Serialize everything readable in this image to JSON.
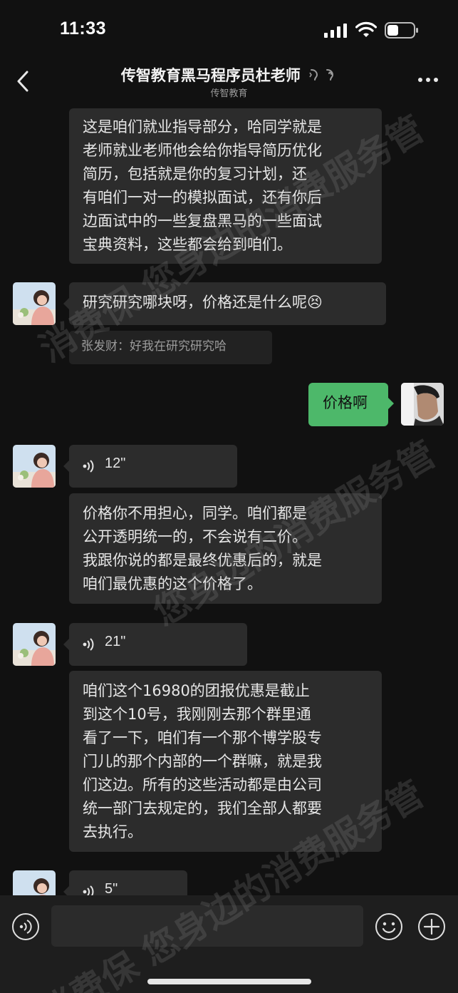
{
  "status_bar": {
    "time": "11:33",
    "signal_icon": "cellular-signal-icon",
    "wifi_icon": "wifi-icon",
    "battery_icon": "battery-icon"
  },
  "header": {
    "title": "传智教育黑马程序员杜老师",
    "subtitle": "传智教育",
    "back_icon": "chevron-left-icon",
    "more_icon": "more-dots-icon",
    "earpiece_icon": "earpiece-mode-icon"
  },
  "messages": [
    {
      "type": "text",
      "from": "other",
      "text": "这是咱们就业指导部分，哈同学就是老师就业老师他会给你指导简历优化简历，包括就是你的复习计划，还有咱们一对一的模拟面试，还有你后边面试中的一些复盘黑马的一些面试宝典资料，这些都会给到咱们。"
    },
    {
      "type": "text",
      "from": "other",
      "text": "研究研究哪块呀，价格还是什么呢",
      "emoji": "😣"
    },
    {
      "type": "quote",
      "text": "张发财：好我在研究研究哈"
    },
    {
      "type": "text",
      "from": "me",
      "text": "价格啊"
    },
    {
      "type": "voice",
      "from": "other",
      "duration": "12\""
    },
    {
      "type": "text",
      "from": "other",
      "text": "价格你不用担心，同学。咱们都是公开透明统一的，不会说有二价。我跟你说的都是最终优惠后的，就是咱们最优惠的这个价格了。"
    },
    {
      "type": "voice",
      "from": "other",
      "duration": "21\""
    },
    {
      "type": "text",
      "from": "other",
      "text": "咱们这个16980的团报优惠是截止到这个10号，我刚刚去那个群里通看了一下，咱们有一个那个博学股专门儿的那个内部的一个群嘛，就是我们这边。所有的这些活动都是由公司统一部门去规定的，我们全部人都要去执行。"
    },
    {
      "type": "voice",
      "from": "other",
      "duration": "5\""
    }
  ],
  "lines": {
    "m0": [
      "这是咱们就业指导部分，哈同学就是",
      "老师就业老师他会给你指导简历优化",
      "简历，包括就是你的复习计划，还",
      "有咱们一对一的模拟面试，还有你后",
      "边面试中的一些复盘黑马的一些面试",
      "宝典资料，这些都会给到咱们。"
    ],
    "m5": [
      "价格你不用担心，同学。咱们都是",
      "公开透明统一的，不会说有二价。",
      "我跟你说的都是最终优惠后的，就是",
      "咱们最优惠的这个价格了。"
    ],
    "m7": [
      "咱们这个16980的团报优惠是截止",
      "到这个10号，我刚刚去那个群里通",
      "看了一下，咱们有一个那个博学股专",
      "门儿的那个内部的一个群嘛，就是我",
      "们这边。所有的这些活动都是由公司",
      "统一部门去规定的，我们全部人都要",
      "去执行。"
    ]
  },
  "watermark": {
    "text_a": "消费保 您身边的消费服务管",
    "text_b": "您身边的消费服务管",
    "text_c": "消费保 您身边的消费服务管"
  },
  "input_bar": {
    "placeholder": "",
    "voice_icon": "voice-input-icon",
    "emoji_icon": "emoji-smile-icon",
    "plus_icon": "plus-circle-icon"
  },
  "colors": {
    "background": "#111111",
    "bubble_other": "#2c2c2c",
    "bubble_me": "#4db86a",
    "quote": "#222222"
  }
}
